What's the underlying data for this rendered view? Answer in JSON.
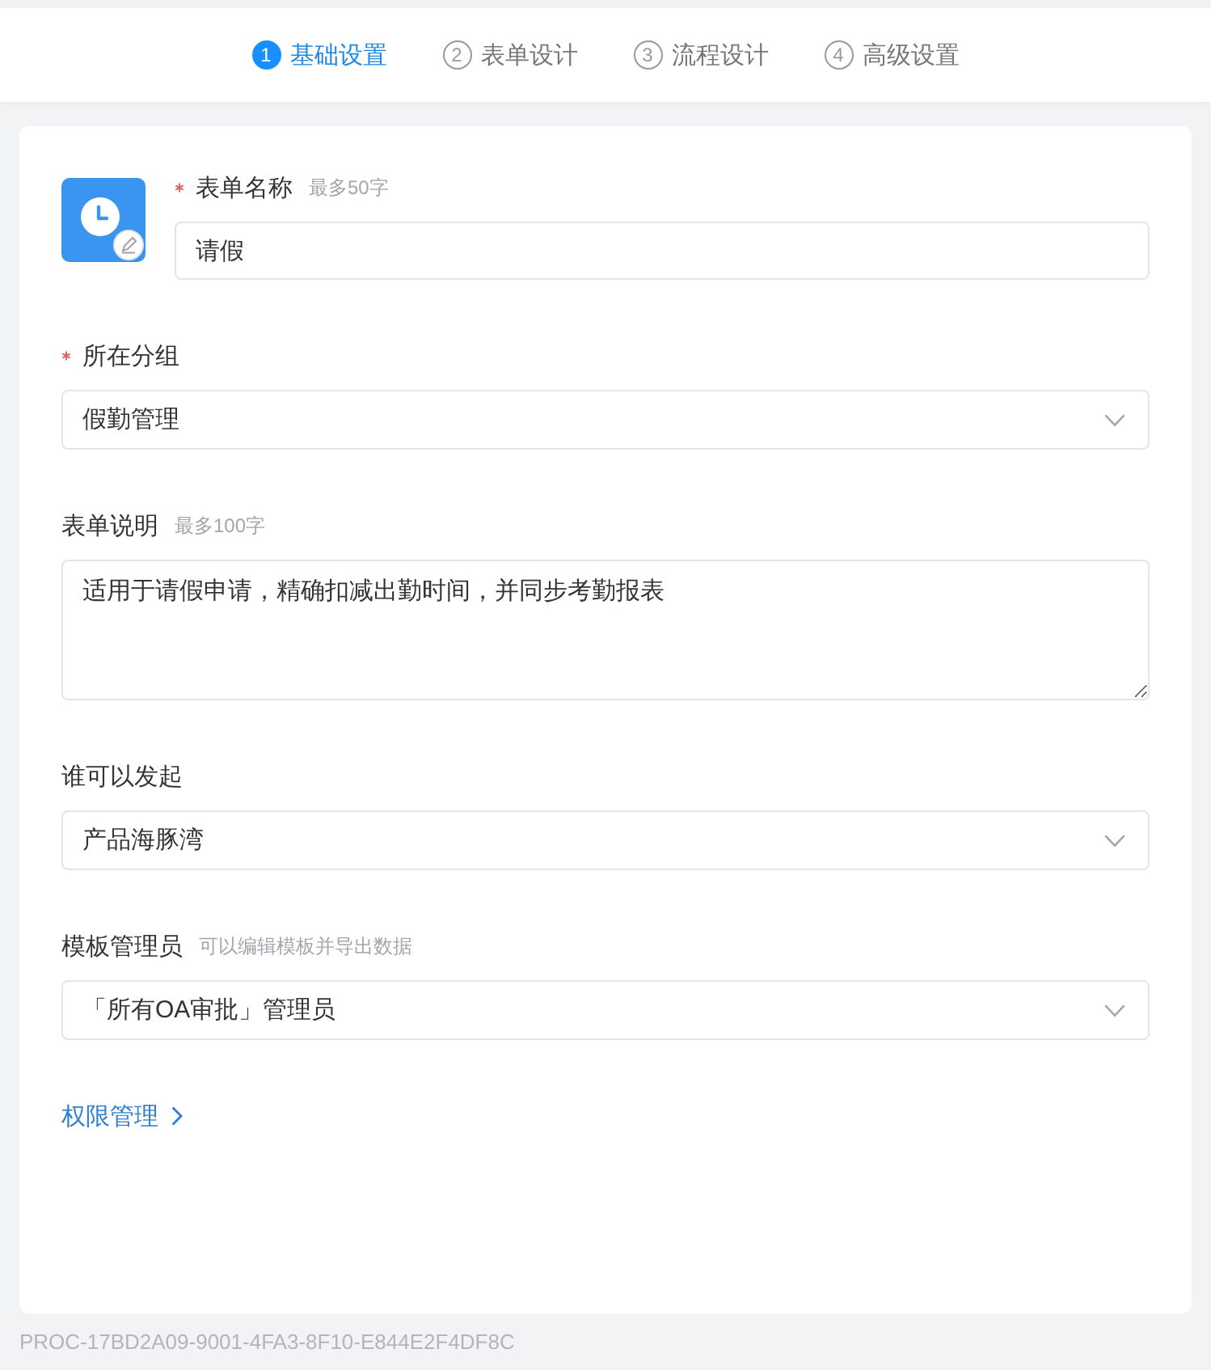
{
  "steps": [
    {
      "number": "1",
      "label": "基础设置",
      "selected": true
    },
    {
      "number": "2",
      "label": "表单设计",
      "selected": false
    },
    {
      "number": "3",
      "label": "流程设计",
      "selected": false
    },
    {
      "number": "4",
      "label": "高级设置",
      "selected": false
    }
  ],
  "form": {
    "name_field": {
      "label": "表单名称",
      "required": true,
      "hint": "最多50字",
      "kind": "input",
      "value": "请假"
    },
    "fields": [
      {
        "label": "所在分组",
        "required": true,
        "kind": "select",
        "value": "假勤管理"
      },
      {
        "label": "表单说明",
        "required": false,
        "hint": "最多100字",
        "kind": "textarea",
        "value": "适用于请假申请，精确扣减出勤时间，并同步考勤报表"
      },
      {
        "label": "谁可以发起",
        "required": false,
        "kind": "select",
        "value": "产品海豚湾"
      },
      {
        "label": "模板管理员",
        "required": false,
        "hint": "可以编辑模板并导出数据",
        "kind": "select",
        "value": "「所有OA审批」管理员"
      }
    ],
    "permission_link": {
      "label": "权限管理"
    }
  },
  "footer": {
    "process_id": "PROC-17BD2A09-9001-4FA3-8F10-E844E2F4DF8C"
  }
}
